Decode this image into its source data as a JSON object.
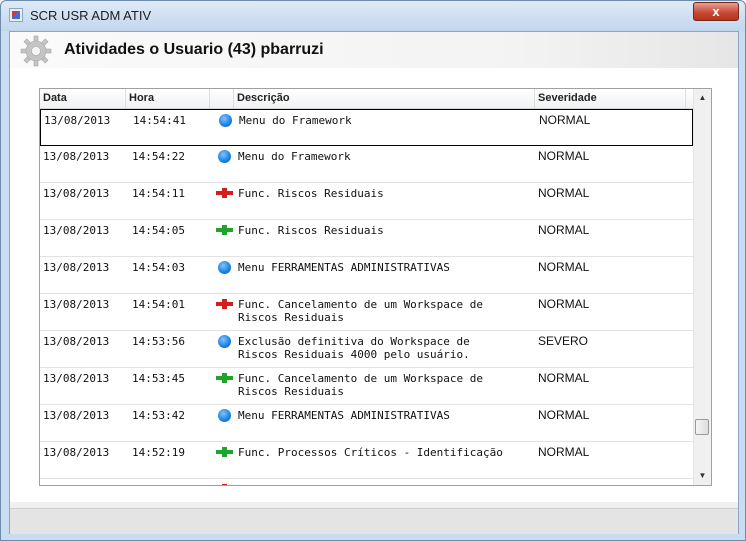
{
  "window": {
    "title": "SCR USR ADM ATIV",
    "close_label": "x"
  },
  "header": {
    "title": "Atividades o Usuario (43) pbarruzi",
    "icon": "gear-icon"
  },
  "grid": {
    "columns": [
      "Data",
      "Hora",
      "",
      "Descrição",
      "Severidade"
    ],
    "rows": [
      {
        "date": "13/08/2013",
        "time": "14:54:41",
        "icon": "blue-circle-icon",
        "desc": "Menu do Framework",
        "sev": "NORMAL"
      },
      {
        "date": "13/08/2013",
        "time": "14:54:22",
        "icon": "blue-circle-icon",
        "desc": "Menu do Framework",
        "sev": "NORMAL"
      },
      {
        "date": "13/08/2013",
        "time": "14:54:11",
        "icon": "red-plus-icon",
        "desc": "Func. Riscos Residuais",
        "sev": "NORMAL"
      },
      {
        "date": "13/08/2013",
        "time": "14:54:05",
        "icon": "green-plus-icon",
        "desc": "Func. Riscos Residuais",
        "sev": "NORMAL"
      },
      {
        "date": "13/08/2013",
        "time": "14:54:03",
        "icon": "blue-circle-icon",
        "desc": "Menu FERRAMENTAS ADMINISTRATIVAS",
        "sev": "NORMAL"
      },
      {
        "date": "13/08/2013",
        "time": "14:54:01",
        "icon": "red-plus-icon",
        "desc": "Func. Cancelamento de um Workspace de\nRiscos Residuais",
        "sev": "NORMAL"
      },
      {
        "date": "13/08/2013",
        "time": "14:53:56",
        "icon": "blue-circle-icon",
        "desc": "Exclusão definitiva do Workspace de\nRiscos Residuais 4000 pelo usuário.",
        "sev": "SEVERO"
      },
      {
        "date": "13/08/2013",
        "time": "14:53:45",
        "icon": "green-plus-icon",
        "desc": "Func. Cancelamento de um Workspace de\nRiscos Residuais",
        "sev": "NORMAL"
      },
      {
        "date": "13/08/2013",
        "time": "14:53:42",
        "icon": "blue-circle-icon",
        "desc": "Menu FERRAMENTAS ADMINISTRATIVAS",
        "sev": "NORMAL"
      },
      {
        "date": "13/08/2013",
        "time": "14:52:19",
        "icon": "green-plus-icon",
        "desc": "Func. Processos Críticos - Identificação",
        "sev": "NORMAL"
      },
      {
        "date": "",
        "time": "",
        "icon": "red-plus-icon",
        "desc": "",
        "sev": ""
      }
    ],
    "selected_index": 0
  },
  "scrollbar": {
    "up_arrow": "▲",
    "down_arrow": "▼"
  }
}
